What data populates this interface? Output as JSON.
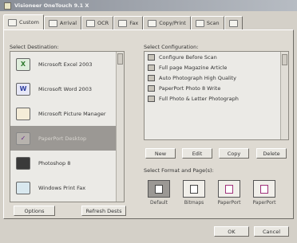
{
  "window": {
    "title": "Visioneer OneTouch 9.1 X"
  },
  "tabs": [
    {
      "label": "Custom",
      "icon": "custom-tab-icon"
    },
    {
      "label": "Arrival",
      "icon": "scanner-icon"
    },
    {
      "label": "OCR",
      "icon": "ocr-icon"
    },
    {
      "label": "Fax",
      "icon": "fax-icon"
    },
    {
      "label": "Copy/Print",
      "icon": "printer-icon"
    },
    {
      "label": "Scan",
      "icon": "scan-icon"
    },
    {
      "label": "",
      "icon": "folder-icon"
    }
  ],
  "destinations": {
    "label": "Select Destination:",
    "items": [
      {
        "label": "Microsoft Excel 2003",
        "icon": "excel-icon"
      },
      {
        "label": "Microsoft Word 2003",
        "icon": "word-icon"
      },
      {
        "label": "Microsoft Picture Manager",
        "icon": "picture-manager-icon"
      },
      {
        "label": "PaperPort Desktop",
        "icon": "paperport-icon"
      },
      {
        "label": "Photoshop 8",
        "icon": "photoshop-icon"
      },
      {
        "label": "Windows Print Fax",
        "icon": "print-fax-icon"
      }
    ],
    "selected_index": 3
  },
  "configurations": {
    "label": "Select Configuration:",
    "items": [
      "Configure Before Scan",
      "Full page Magazine Article",
      "Auto Photograph High Quality",
      "PaperPort Photo 8 Write",
      "Full Photo & Letter Photograph"
    ]
  },
  "buttons": {
    "options": "Options",
    "refresh": "Refresh Dests",
    "new": "New",
    "edit": "Edit",
    "copy": "Copy",
    "delete": "Delete",
    "ok": "OK",
    "cancel": "Cancel"
  },
  "formats": {
    "label": "Select Format and Page(s):",
    "items": [
      "Default",
      "Bitmaps",
      "PaperPort",
      "PaperPort"
    ],
    "selected_index": 0
  }
}
